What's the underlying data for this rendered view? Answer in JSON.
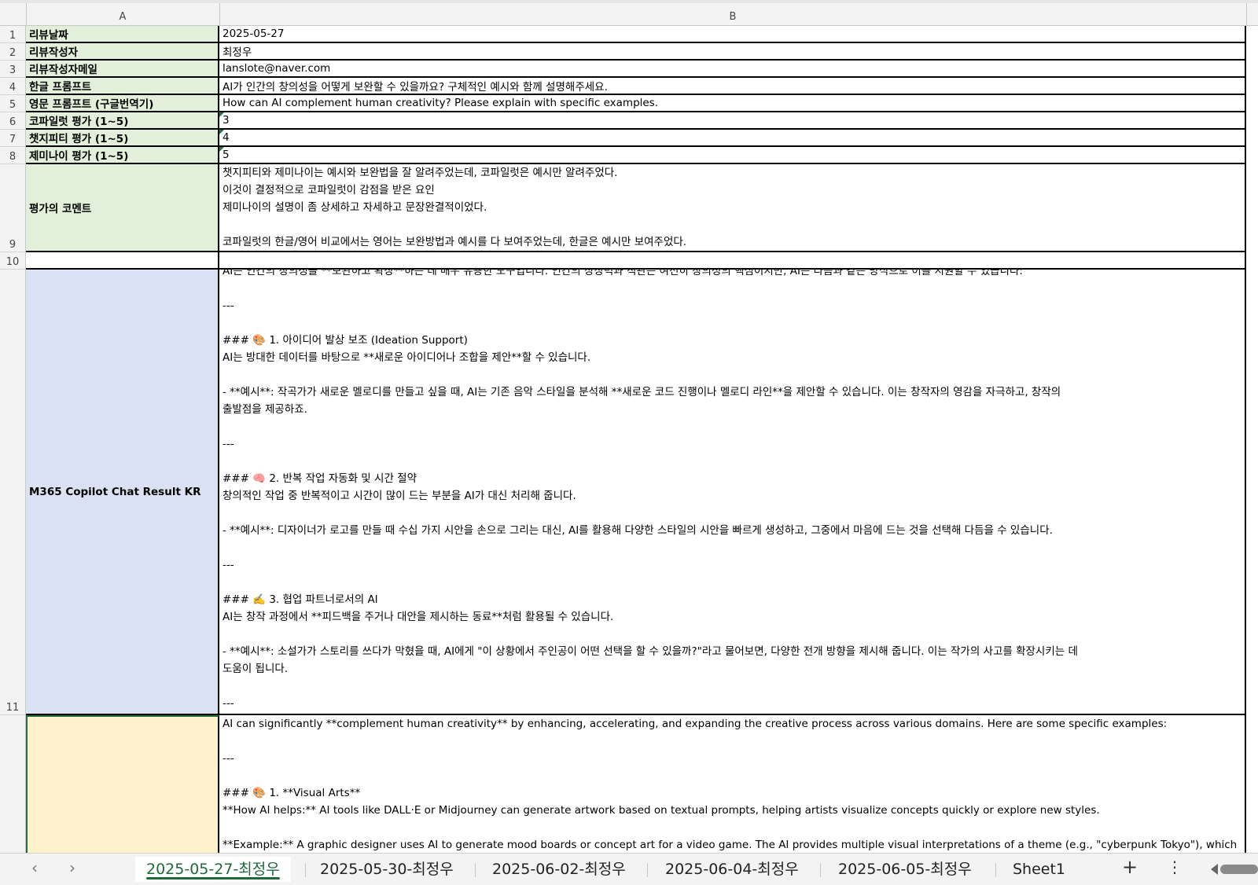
{
  "columns": [
    "A",
    "B"
  ],
  "rows": [
    {
      "num": "1",
      "label": "리뷰날짜",
      "value": "2025-05-27"
    },
    {
      "num": "2",
      "label": "리뷰작성자",
      "value": "최정우"
    },
    {
      "num": "3",
      "label": "리뷰작성자메일",
      "value": "lanslote@naver.com"
    },
    {
      "num": "4",
      "label": "한글 프롬프트",
      "value": "AI가 인간의 창의성을 어떻게 보완할 수 있을까요? 구체적인 예시와 함께 설명해주세요."
    },
    {
      "num": "5",
      "label": "영문 프롬프트 (구글번역기)",
      "value": "How can AI complement human creativity? Please explain with specific examples."
    },
    {
      "num": "6",
      "label": "코파일럿 평가 (1~5)",
      "value": "3"
    },
    {
      "num": "7",
      "label": "챗지피티 평가 (1~5)",
      "value": "4"
    },
    {
      "num": "8",
      "label": "제미나이 평가 (1~5)",
      "value": "5"
    }
  ],
  "row9": {
    "num": "9",
    "label": "평가의 코멘트",
    "lines": [
      "챗지피티와 제미나이는 예시와 보완법을 잘 알려주었는데, 코파일럿은 예시만 알려주었다.",
      "이것이 결정적으로 코파일럿이 감점을 받은 요인",
      "제미나이의 설명이 좀 상세하고 자세하고 문장완결적이었다.",
      "",
      "코파일럿의 한글/영어 비교에서는 영어는 보완방법과 예시를 다 보여주었는데, 한글은 예시만 보여주었다."
    ]
  },
  "row10": {
    "num": "10"
  },
  "row11": {
    "num": "11",
    "label": "M365 Copilot Chat Result KR",
    "lines": [
      "AI는 인간의 창의성을 **보완하고 확장**하는 데 매우 유용한 도구입니다. 인간의 상상력과 직관은 여전히 창의성의 핵심이지만, AI는 다음과 같은 방식으로 이를 지원할 수 있습니다:",
      "",
      "---",
      "",
      "### 🎨 1. 아이디어 발상 보조 (Ideation Support)",
      "AI는 방대한 데이터를 바탕으로 **새로운 아이디어나 조합을 제안**할 수 있습니다.",
      "",
      "- **예시**: 작곡가가 새로운 멜로디를 만들고 싶을 때, AI는 기존 음악 스타일을 분석해 **새로운 코드 진행이나 멜로디 라인**을 제안할 수 있습니다. 이는 창작자의 영감을 자극하고, 창작의",
      "출발점을 제공하죠.",
      "",
      "---",
      "",
      "### 🧠 2. 반복 작업 자동화 및 시간 절약",
      "창의적인 작업 중 반복적이고 시간이 많이 드는 부분을 AI가 대신 처리해 줍니다.",
      "",
      "- **예시**: 디자이너가 로고를 만들 때 수십 가지 시안을 손으로 그리는 대신, AI를 활용해 다양한 스타일의 시안을 빠르게 생성하고, 그중에서 마음에 드는 것을 선택해 다듬을 수 있습니다.",
      "",
      "---",
      "",
      "### ✍️ 3. 협업 파트너로서의 AI",
      "AI는 창작 과정에서 **피드백을 주거나 대안을 제시하는 동료**처럼 활용될 수 있습니다.",
      "",
      "- **예시**: 소설가가 스토리를 쓰다가 막혔을 때, AI에게 \"이 상황에서 주인공이 어떤 선택을 할 수 있을까?\"라고 물어보면, 다양한 전개 방향을 제시해 줍니다. 이는 작가의 사고를 확장시키는 데",
      "도움이 됩니다.",
      "",
      "---"
    ]
  },
  "row12": {
    "lines": [
      "AI can significantly **complement human creativity** by enhancing, accelerating, and expanding the creative process across various domains. Here are some specific examples:",
      "",
      "---",
      "",
      "### 🎨 1. **Visual Arts**",
      "**How AI helps:** AI tools like DALL·E or Midjourney can generate artwork based on textual prompts, helping artists visualize concepts quickly or explore new styles.",
      "",
      "**Example:** A graphic designer uses AI to generate mood boards or concept art for a video game. The AI provides multiple visual interpretations of a theme (e.g., \"cyberpunk Tokyo\"), which"
    ]
  },
  "tabs": [
    "2025-05-27-최정우",
    "2025-05-30-최정우",
    "2025-06-02-최정우",
    "2025-06-04-최정우",
    "2025-06-05-최정우",
    "Sheet1"
  ],
  "icons": {
    "prev": "chevron-left-icon",
    "next": "chevron-right-icon",
    "add": "plus-icon",
    "more": "more-vertical-icon"
  },
  "colors": {
    "label_green": "#e2efda",
    "label_blue": "#d9e1f2",
    "label_yellow": "#fff2cc",
    "active_tab": "#1e6b3a"
  }
}
